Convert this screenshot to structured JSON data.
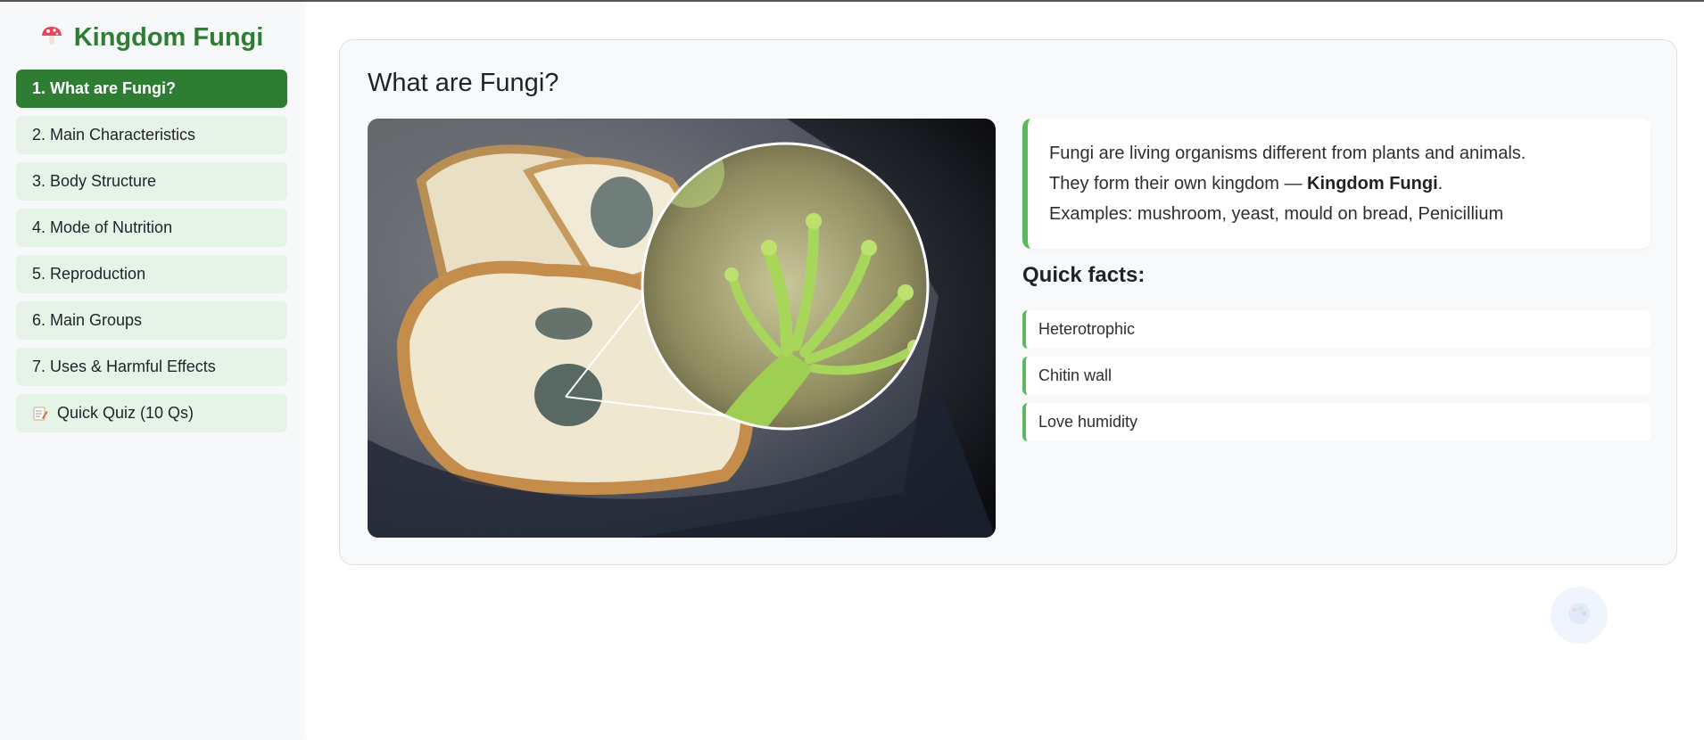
{
  "sidebar": {
    "brand": {
      "icon": "mushroom-icon",
      "title": "Kingdom Fungi"
    },
    "items": [
      {
        "label": "1. What are Fungi?",
        "active": true
      },
      {
        "label": "2. Main Characteristics"
      },
      {
        "label": "3. Body Structure"
      },
      {
        "label": "4. Mode of Nutrition"
      },
      {
        "label": "5. Reproduction"
      },
      {
        "label": "6. Main Groups"
      },
      {
        "label": "7. Uses & Harmful Effects"
      },
      {
        "label": "Quick Quiz (10 Qs)",
        "icon": "memo-icon"
      }
    ]
  },
  "main": {
    "title": "What are Fungi?",
    "image": {
      "description_icon": "mould-on-bread-image"
    },
    "intro": {
      "line1": "Fungi are living organisms different from plants and animals.",
      "line2_prefix": "They form their own kingdom — ",
      "line2_bold": "Kingdom Fungi",
      "line2_suffix": ".",
      "line3": "Examples: mushroom, yeast, mould on bread, Penicillium"
    },
    "facts_heading": "Quick facts:",
    "facts": [
      "Heterotrophic",
      "Chitin wall",
      "Love humidity"
    ]
  },
  "colors": {
    "brand": "#2e7d32",
    "nav_bg": "#e6f4e8",
    "accent": "#5cb85c"
  }
}
